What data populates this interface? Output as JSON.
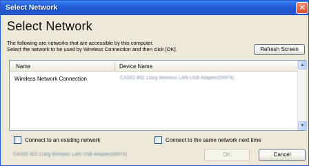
{
  "window": {
    "title": "Select Network",
    "close_glyph": "✕"
  },
  "main": {
    "heading": "Select Network",
    "description_line1": "The following are networks that are accessible by this computer.",
    "description_line2": "Select the network to be used by Wireless Connection and then click [OK].",
    "refresh_label": "Refresh Screen"
  },
  "list": {
    "columns": [
      "Name",
      "Device Name"
    ],
    "rows": [
      {
        "name": "Wireless Network Connection",
        "device": "CASIO 802.11b/g Wireless LAN USB Adapter(08974)"
      }
    ]
  },
  "options": {
    "existing_label": "Connect to an existing network",
    "existing_checked": false,
    "same_next_label": "Connect to the same network next time",
    "same_next_checked": false
  },
  "footer": {
    "adapter_text": "CASIO 802.11b/g Wireless LAN USB Adapter(08974)",
    "ok_label": "OK",
    "cancel_label": "Cancel"
  },
  "icons": {
    "scroll_up": "up-arrow-icon",
    "scroll_down": "down-arrow-icon"
  },
  "colors": {
    "titlebar": "#1d57d2",
    "close_button": "#d84d2b",
    "dialog_bg": "#ece9d8"
  }
}
